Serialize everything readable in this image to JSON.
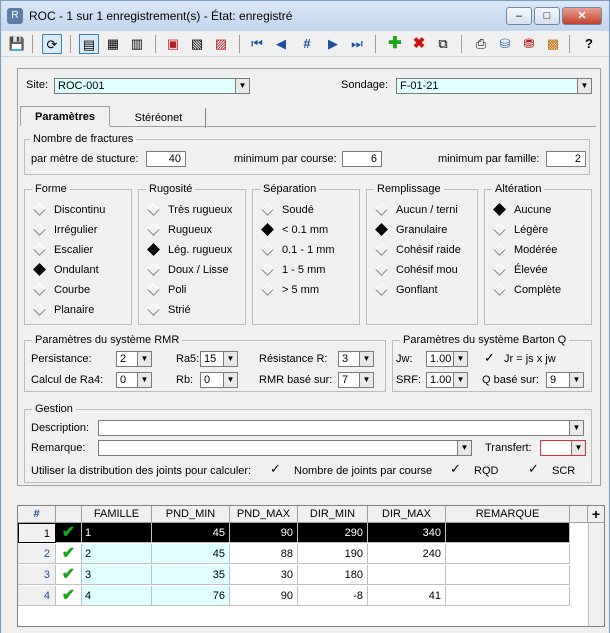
{
  "window": {
    "title": "ROC - 1 sur 1 enregistrement(s) - État: enregistré",
    "app_icon": "database-app-icon"
  },
  "toolbar": {
    "icons": [
      "save-icon",
      "refresh-icon",
      "form-view-icon",
      "table-view-icon",
      "list-view-icon",
      "export-icon",
      "import-icon",
      "delete-file-icon",
      "first-record-icon",
      "prev-record-icon",
      "record-number-icon",
      "next-record-icon",
      "last-record-icon",
      "add-record-icon",
      "delete-record-icon",
      "copy-record-icon",
      "print-icon",
      "database-icon",
      "database-refresh-icon",
      "grid-color-icon",
      "help-icon"
    ],
    "help_label": "?",
    "goto_label": "#"
  },
  "header": {
    "site_label": "Site:",
    "site_value": "ROC-001",
    "sondage_label": "Sondage:",
    "sondage_value": "F-01-21"
  },
  "tabs": [
    {
      "label": "Paramètres"
    },
    {
      "label": "Stéréonet"
    }
  ],
  "fractures": {
    "title": "Nombre de fractures",
    "par_metre_label": "par mètre de stucture:",
    "par_metre_value": "40",
    "min_course_label": "minimum par course:",
    "min_course_value": "6",
    "min_famille_label": "minimum par famille:",
    "min_famille_value": "2"
  },
  "forme": {
    "title": "Forme",
    "options": [
      "Discontinu",
      "Irrégulier",
      "Escalier",
      "Ondulant",
      "Courbe",
      "Planaire"
    ],
    "selected": "Ondulant"
  },
  "rugosite": {
    "title": "Rugosité",
    "options": [
      "Très rugueux",
      "Rugueux",
      "Lég. rugueux",
      "Doux / Lisse",
      "Poli",
      "Strié"
    ],
    "selected": "Lég. rugueux"
  },
  "separation": {
    "title": "Séparation",
    "options": [
      "Soudé",
      "< 0.1 mm",
      "0.1 - 1 mm",
      "1 - 5 mm",
      "> 5 mm"
    ],
    "selected": "< 0.1 mm"
  },
  "remplissage": {
    "title": "Remplissage",
    "options": [
      "Aucun / terni",
      "Granulaire",
      "Cohésif raide",
      "Cohésif mou",
      "Gonflant"
    ],
    "selected": "Granulaire"
  },
  "alteration": {
    "title": "Altération",
    "options": [
      "Aucune",
      "Légère",
      "Modérée",
      "Élevée",
      "Complète"
    ],
    "selected": "Aucune"
  },
  "rmr": {
    "title": "Paramètres du système RMR",
    "persistance_label": "Persistance:",
    "persistance_value": "2",
    "ra5_label": "Ra5:",
    "ra5_value": "15",
    "resistance_label": "Résistance R:",
    "resistance_value": "3",
    "calcul_ra4_label": "Calcul de Ra4:",
    "calcul_ra4_value": "0",
    "rb_label": "Rb:",
    "rb_value": "0",
    "rmr_base_label": "RMR basé sur:",
    "rmr_base_value": "7"
  },
  "barton": {
    "title": "Paramètres du système Barton Q",
    "jw_label": "Jw:",
    "jw_value": "1.00",
    "jr_label": "Jr = js x jw",
    "srf_label": "SRF:",
    "srf_value": "1.00",
    "q_base_label": "Q basé sur:",
    "q_base_value": "9"
  },
  "gestion": {
    "title": "Gestion",
    "description_label": "Description:",
    "description_value": "",
    "remarque_label": "Remarque:",
    "remarque_value": "",
    "transfert_label": "Transfert:",
    "transfert_value": "",
    "distribution_label": "Utiliser la distribution des joints pour calculer:",
    "opt_nombre": "Nombre de joints par course",
    "opt_rqd": "RQD",
    "opt_scr": "SCR"
  },
  "table": {
    "columns": [
      "#",
      "",
      "FAMILLE",
      "PND_MIN",
      "PND_MAX",
      "DIR_MIN",
      "DIR_MAX",
      "REMARQUE"
    ],
    "add_label": "+",
    "rows": [
      {
        "n": "1",
        "famille": "1",
        "pnd_min": "45",
        "pnd_max": "90",
        "dir_min": "290",
        "dir_max": "340",
        "remarque": ""
      },
      {
        "n": "2",
        "famille": "2",
        "pnd_min": "45",
        "pnd_max": "88",
        "dir_min": "190",
        "dir_max": "240",
        "remarque": ""
      },
      {
        "n": "3",
        "famille": "3",
        "pnd_min": "35",
        "pnd_max": "30",
        "dir_min": "180",
        "dir_max": "",
        "remarque": ""
      },
      {
        "n": "4",
        "famille": "4",
        "pnd_min": "76",
        "pnd_max": "90",
        "dir_min": "-8",
        "dir_max": "41",
        "remarque": ""
      }
    ]
  },
  "colors": {
    "selected_row": "#000000",
    "cyan_field": "#e0ffff",
    "check_green": "#1aa41a",
    "highlight_border": "#e03030"
  }
}
